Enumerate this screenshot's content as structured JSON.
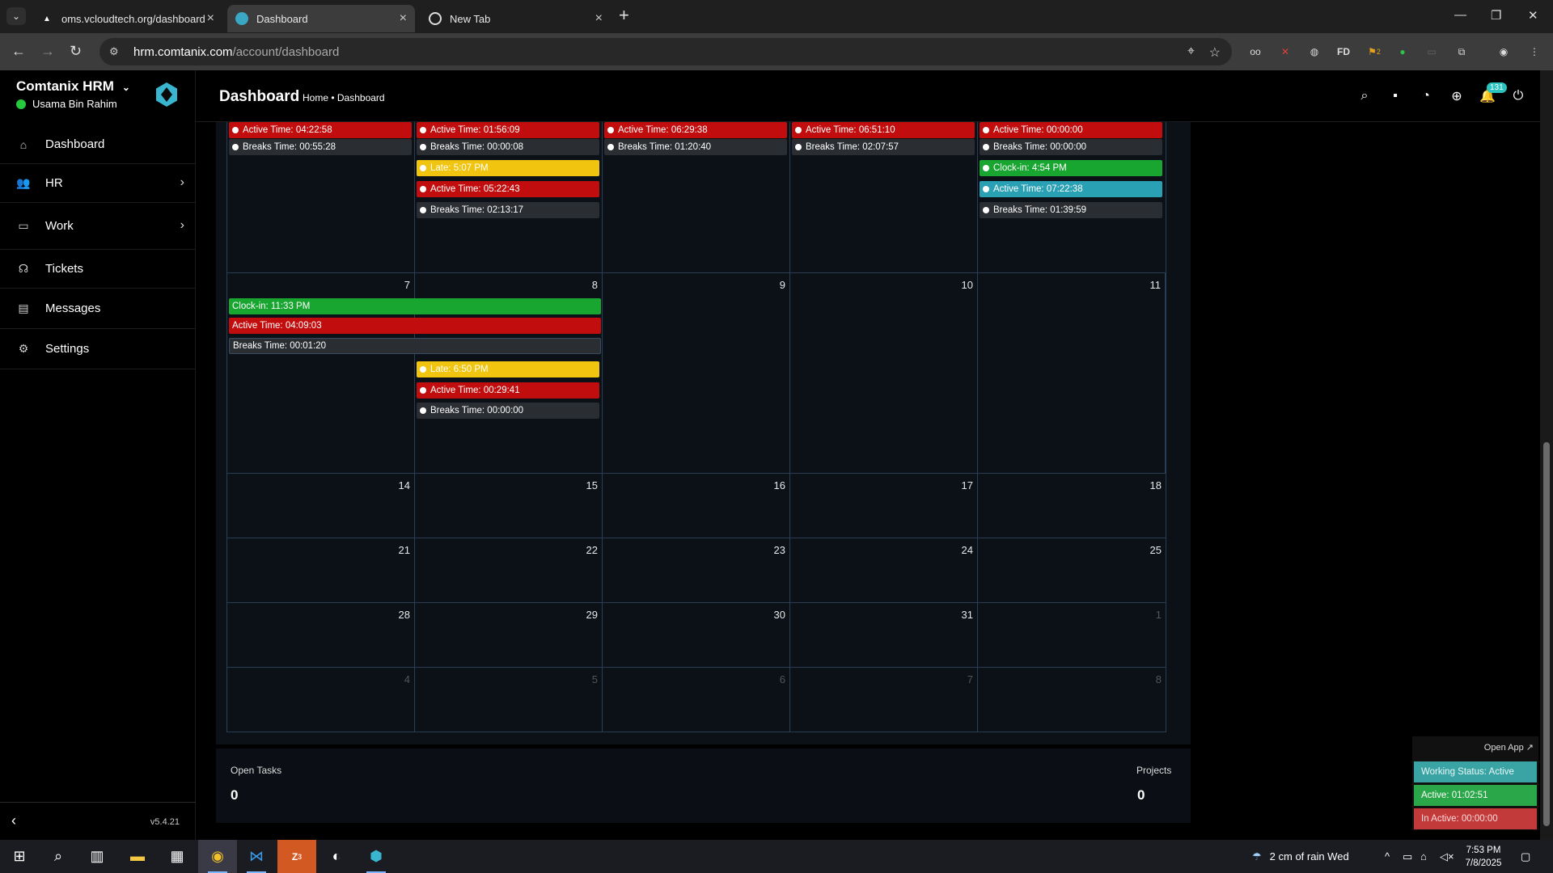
{
  "browser": {
    "tabs": [
      {
        "title": "oms.vcloudtech.org/dashboard",
        "active": false
      },
      {
        "title": "Dashboard",
        "active": true
      },
      {
        "title": "New Tab",
        "active": false
      }
    ],
    "url_host": "hrm.comtanix.com",
    "url_path": "/account/dashboard",
    "extensions": [
      "glasses-icon",
      "x-icon",
      "globe-icon",
      "FD",
      "badge-2-icon",
      "leaf-icon",
      "tab-icon",
      "puzzle-icon",
      "profile-icon",
      "menu-icon"
    ],
    "ext_fd_label": "FD",
    "ext_badge_count": "2"
  },
  "sidebar": {
    "brand": "Comtanix HRM",
    "user": "Usama Bin Rahim",
    "items": [
      {
        "label": "Dashboard",
        "icon": "home-icon",
        "arrow": false
      },
      {
        "label": "HR",
        "icon": "users-icon",
        "arrow": true
      },
      {
        "label": "Work",
        "icon": "briefcase-icon",
        "arrow": true
      },
      {
        "label": "Tickets",
        "icon": "headset-icon",
        "arrow": false
      },
      {
        "label": "Messages",
        "icon": "message-icon",
        "arrow": false
      },
      {
        "label": "Settings",
        "icon": "gear-icon",
        "arrow": false
      }
    ],
    "version": "v5.4.21"
  },
  "header": {
    "title": "Dashboard",
    "breadcrumb": "Home • Dashboard",
    "notification_count": "131"
  },
  "calendar": {
    "top_row": {
      "cells": [
        {
          "events": [
            {
              "type": "red",
              "text": "Active Time: 04:22:58"
            },
            {
              "type": "dark",
              "text": "Breaks Time: 00:55:28"
            }
          ]
        },
        {
          "events": [
            {
              "type": "red",
              "text": "Active Time: 01:56:09"
            },
            {
              "type": "dark",
              "text": "Breaks Time: 00:00:08"
            },
            {
              "type": "yellow",
              "text": "Late: 5:07 PM"
            },
            {
              "type": "red",
              "text": "Active Time: 05:22:43"
            },
            {
              "type": "dark",
              "text": "Breaks Time: 02:13:17"
            }
          ]
        },
        {
          "events": [
            {
              "type": "red",
              "text": "Active Time: 06:29:38"
            },
            {
              "type": "dark",
              "text": "Breaks Time: 01:20:40"
            }
          ]
        },
        {
          "events": [
            {
              "type": "red",
              "text": "Active Time: 06:51:10"
            },
            {
              "type": "dark",
              "text": "Breaks Time: 02:07:57"
            }
          ]
        },
        {
          "events": [
            {
              "type": "red",
              "text": "Active Time: 00:00:00"
            },
            {
              "type": "dark",
              "text": "Breaks Time: 00:00:00"
            },
            {
              "type": "green",
              "text": "Clock-in: 4:54 PM"
            },
            {
              "type": "teal",
              "text": "Active Time: 07:22:38"
            },
            {
              "type": "dark",
              "text": "Breaks Time: 01:39:59"
            }
          ]
        }
      ]
    },
    "week2": {
      "days": [
        "7",
        "8",
        "9",
        "10",
        "11"
      ],
      "spanning": [
        {
          "type": "green",
          "text": "Clock-in: 11:33 PM"
        },
        {
          "type": "red",
          "text": "Active Time: 04:09:03"
        },
        {
          "type": "dark",
          "text": "Breaks Time: 00:01:20"
        }
      ],
      "day8_events": [
        {
          "type": "yellow",
          "text": "Late: 6:50 PM"
        },
        {
          "type": "red",
          "text": "Active Time: 00:29:41"
        },
        {
          "type": "dark",
          "text": "Breaks Time: 00:00:00"
        }
      ]
    },
    "weeks": [
      {
        "days": [
          "14",
          "15",
          "16",
          "17",
          "18"
        ],
        "muted": [
          false,
          false,
          false,
          false,
          false
        ]
      },
      {
        "days": [
          "21",
          "22",
          "23",
          "24",
          "25"
        ],
        "muted": [
          false,
          false,
          false,
          false,
          false
        ]
      },
      {
        "days": [
          "28",
          "29",
          "30",
          "31",
          "1"
        ],
        "muted": [
          false,
          false,
          false,
          false,
          true
        ]
      },
      {
        "days": [
          "4",
          "5",
          "6",
          "7",
          "8"
        ],
        "muted": [
          true,
          true,
          true,
          true,
          true
        ]
      }
    ]
  },
  "stats": {
    "open_tasks_label": "Open Tasks",
    "open_tasks_value": "0",
    "projects_label": "Projects",
    "projects_value": "0"
  },
  "widget": {
    "open_app": "Open App ↗",
    "working_status": "Working Status: Active",
    "active": "Active: 01:02:51",
    "inactive": "In Active: 00:00:00"
  },
  "taskbar": {
    "weather": "2 cm of rain Wed",
    "time": "7:53 PM",
    "date": "7/8/2025",
    "zoom_badge": "3"
  }
}
